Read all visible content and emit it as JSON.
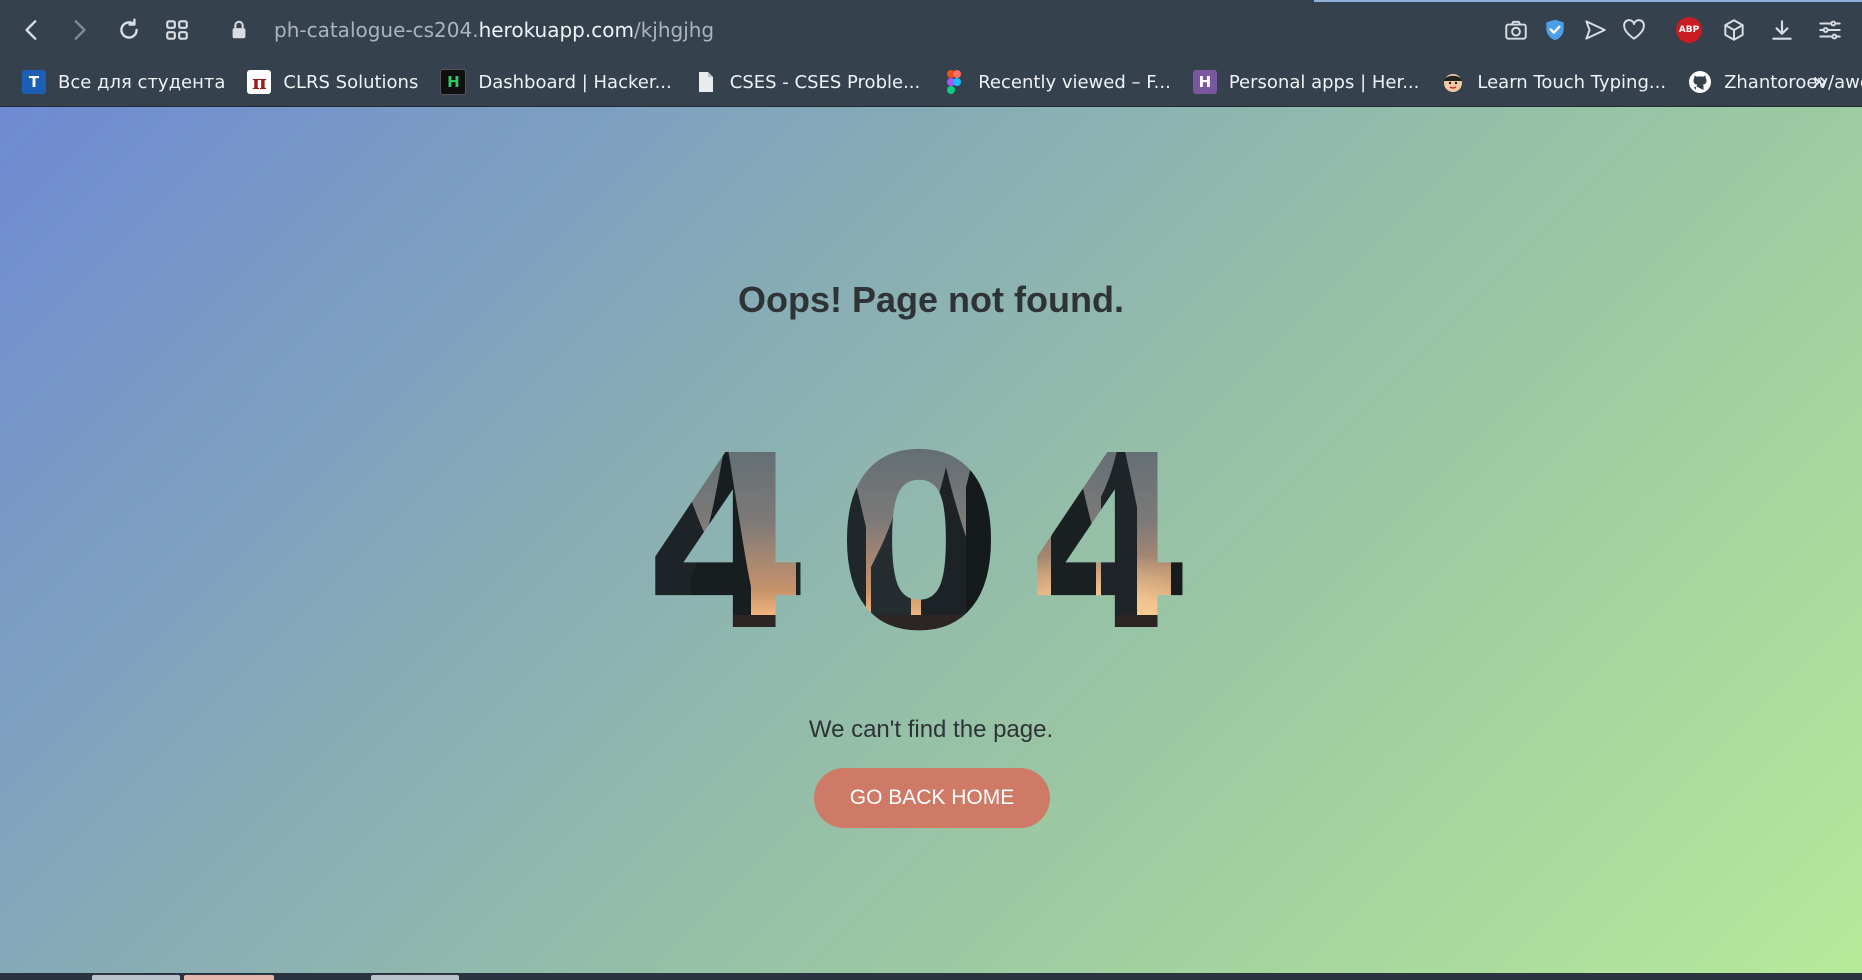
{
  "browser": {
    "address_url_prefix": "ph-catalogue-cs204.",
    "address_url_host": "herokuapp.com",
    "address_url_path": "/kjhgjhg",
    "nav_icons": [
      "back-arrow-icon",
      "forward-arrow-icon",
      "reload-icon",
      "tab-grid-icon",
      "lock-icon"
    ],
    "toolbar_icons": [
      "camera-icon",
      "shield-icon",
      "send-icon",
      "heart-icon",
      "adblock-icon",
      "cube-icon",
      "download-icon",
      "menu-icon"
    ],
    "adblock_label": "ABP"
  },
  "bookmarks": [
    {
      "label": "Все для студента",
      "icon": "t-icon",
      "icon_text": "T",
      "color": "#1d5fb4"
    },
    {
      "label": "CLRS Solutions",
      "icon": "pi-icon",
      "icon_text": "π",
      "color": "#9b1c1c"
    },
    {
      "label": "Dashboard | Hacker...",
      "icon": "hackerrank-icon",
      "icon_text": "H",
      "color": "#0f0f0f"
    },
    {
      "label": "CSES - CSES Proble...",
      "icon": "page-icon",
      "icon_text": "",
      "color": "#e8ecef"
    },
    {
      "label": "Recently viewed – F...",
      "icon": "figma-icon",
      "icon_text": "",
      "color": "#f24e1e"
    },
    {
      "label": "Personal apps | Her...",
      "icon": "heroku-icon",
      "icon_text": "H",
      "color": "#79589f"
    },
    {
      "label": "Learn Touch Typing...",
      "icon": "typing-icon",
      "icon_text": "",
      "color": "#333333"
    },
    {
      "label": "Zhantoroev/aweso...",
      "icon": "github-icon",
      "icon_text": "",
      "color": "#ffffff"
    }
  ],
  "page": {
    "title": "Oops! Page not found.",
    "code": "404",
    "subtitle": "We can't find the page.",
    "button_label": "GO BACK HOME",
    "button_color": "#cf7a66"
  }
}
